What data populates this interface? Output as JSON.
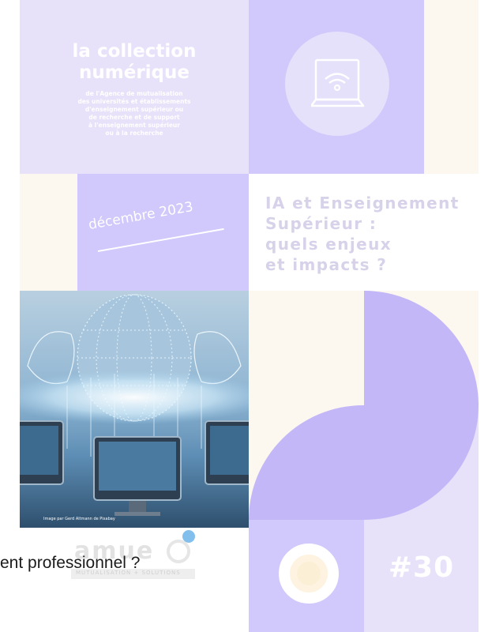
{
  "cover": {
    "collection_title_line1": "la collection",
    "collection_title_line2": "numérique",
    "collection_subtitle": [
      "de l'Agence de mutualisation",
      "des universités et établissements",
      "d'enseignement supérieur ou",
      "de recherche et de support",
      "à l'enseignement supérieur",
      "ou à la recherche"
    ],
    "date": "décembre 2023",
    "title_lines": [
      "IA et Enseignement",
      "Supérieur :",
      "quels enjeux",
      "et impacts ?"
    ],
    "photo_credit": "Image par Gerd Altmann de Pixabay",
    "issue_number": "#30"
  },
  "logo": {
    "word": "amue",
    "tagline": "MUTUALISATION + SOLUTIONS"
  },
  "overlay": {
    "text": "ent professionnel ?"
  },
  "colors": {
    "lavender_light": "#e8e1fa",
    "lavender": "#d1c8fb",
    "cream": "#fdf8ef",
    "accent_blue": "#5aa9e6"
  }
}
